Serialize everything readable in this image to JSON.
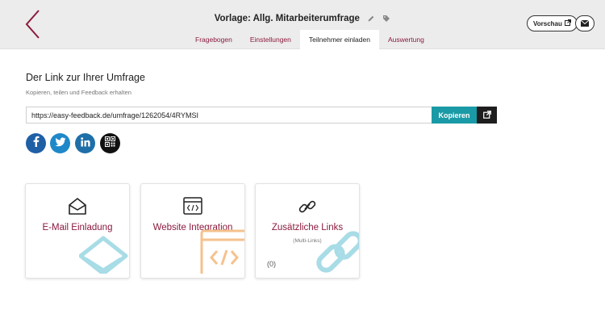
{
  "header": {
    "title": "Vorlage: Allg. Mitarbeiterumfrage",
    "tabs": [
      {
        "label": "Fragebogen"
      },
      {
        "label": "Einstellungen"
      },
      {
        "label": "Teilnehmer einladen",
        "active": true
      },
      {
        "label": "Auswertung"
      }
    ],
    "preview_label": "Vorschau",
    "icons": {
      "back": "chevron-left-icon",
      "edit": "pencil-icon",
      "tag": "tag-icon",
      "external": "external-link-icon",
      "mail": "envelope-icon"
    }
  },
  "link_section": {
    "heading": "Der Link zur Ihrer Umfrage",
    "subheading": "Kopieren, teilen und Feedback erhalten",
    "url": "https://easy-feedback.de/umfrage/1262054/4RYMSI",
    "copy_label": "Kopieren"
  },
  "share": [
    {
      "name": "facebook",
      "icon": "facebook-icon",
      "color": "#1f5fa6"
    },
    {
      "name": "twitter",
      "icon": "twitter-icon",
      "color": "#1e88c8"
    },
    {
      "name": "linkedin",
      "icon": "linkedin-icon",
      "color": "#1e6fa8"
    },
    {
      "name": "qr",
      "icon": "qr-code-icon",
      "color": "#111111"
    }
  ],
  "cards": [
    {
      "title": "E-Mail Einladung",
      "icon": "envelope-open-icon"
    },
    {
      "title": "Website Integration",
      "icon": "code-window-icon"
    },
    {
      "title": "Zusätzliche Links",
      "subtitle": "(Multi-Links)",
      "count": "(0)",
      "icon": "chain-link-icon"
    }
  ],
  "colors": {
    "accent": "#8b1a3c",
    "primary_button": "#1a9aa6",
    "header_bg": "#ececec",
    "deco_blue": "#a8dce6",
    "deco_orange": "#f5c28e"
  }
}
